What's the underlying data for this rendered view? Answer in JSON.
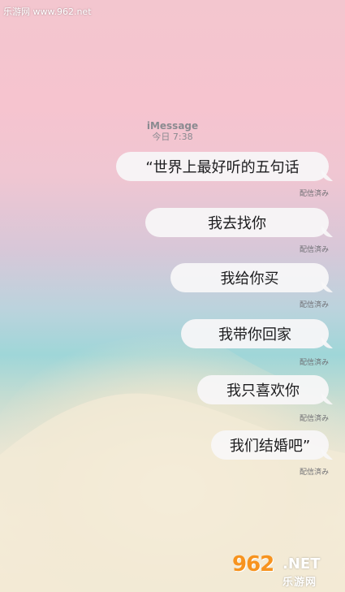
{
  "watermark": {
    "site_text": "乐游网 www.962.net"
  },
  "conversation": {
    "service": "iMessage",
    "timestamp": "今日 7:38"
  },
  "messages": [
    {
      "text": "“世界上最好听的五句话",
      "receipt": "配信済み"
    },
    {
      "text": "我去找你",
      "receipt": "配信済み"
    },
    {
      "text": "我给你买",
      "receipt": "配信済み"
    },
    {
      "text": "我带你回家",
      "receipt": "配信済み"
    },
    {
      "text": "我只喜欢你",
      "receipt": "配信済み"
    },
    {
      "text": "我们结婚吧”",
      "receipt": "配信済み"
    }
  ],
  "logo": {
    "number": "962",
    "domain": ".NET",
    "name": "乐游网"
  },
  "colors": {
    "bubble_bg": "#f8f6f8",
    "text": "#1c1c1e",
    "receipt": "#6e6e73",
    "logo_orange": "#f7931e"
  }
}
